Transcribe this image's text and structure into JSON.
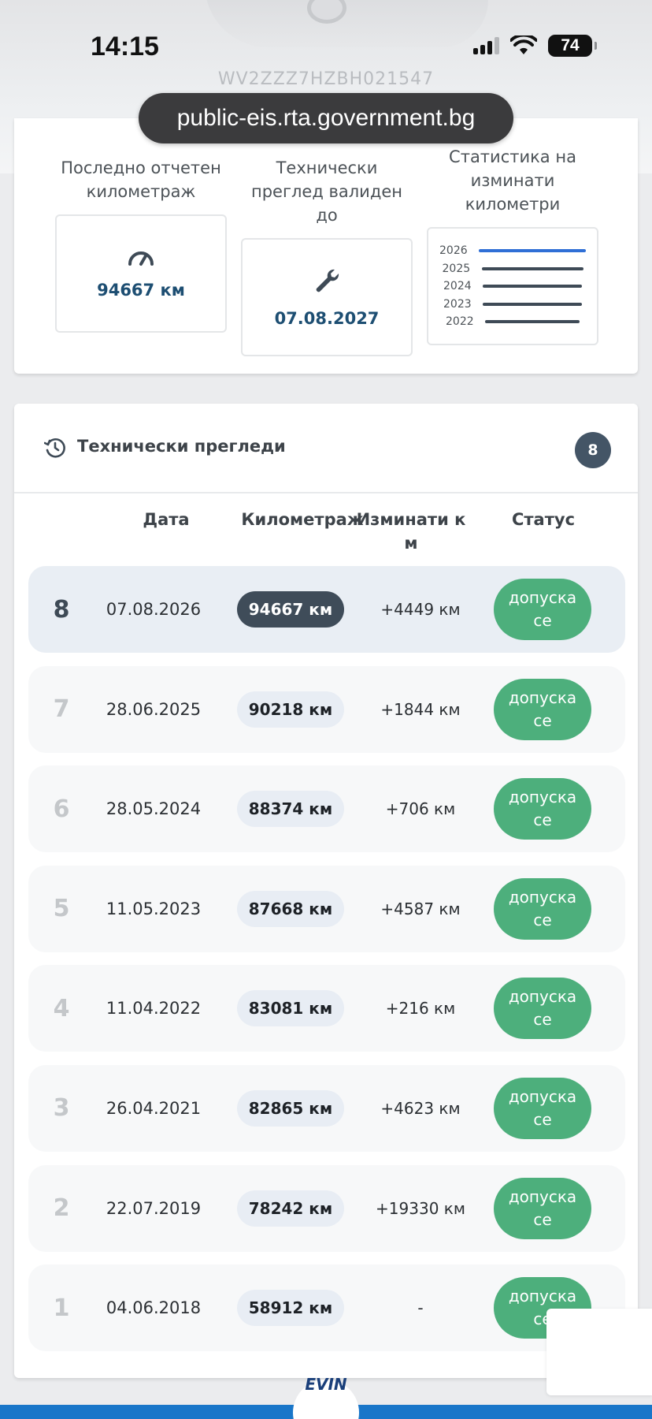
{
  "status_bar": {
    "time": "14:15",
    "battery": "74"
  },
  "vehicle": {
    "vin": "WV2ZZZ7HZBH021547"
  },
  "browser": {
    "url": "public-eis.rta.government.bg"
  },
  "summary": {
    "mileage_label": "Последно отчетен километраж",
    "mileage_value": "94667 км",
    "inspection_label": "Технически преглед валиден до",
    "inspection_value": "07.08.2027",
    "stats_label": "Статистика на изминати километри",
    "stats_chart": {
      "years": [
        "2026",
        "2025",
        "2024",
        "2023",
        "2022"
      ],
      "relative_mileage": [
        1.0,
        0.95,
        0.93,
        0.93,
        0.88
      ],
      "colors": {
        "current": "#2f6fd6",
        "other": "#3e4a56"
      }
    }
  },
  "inspections": {
    "title": "Технически прегледи",
    "count": "8",
    "columns": {
      "date": "Дата",
      "mileage": "Километраж",
      "diff": "Изминати к м",
      "status": "Статус"
    },
    "rows": [
      {
        "num": "8",
        "date": "07.08.2026",
        "km": "94667 км",
        "diff": "+4449 км",
        "status": "допуска се"
      },
      {
        "num": "7",
        "date": "28.06.2025",
        "km": "90218 км",
        "diff": "+1844 км",
        "status": "допуска се"
      },
      {
        "num": "6",
        "date": "28.05.2024",
        "km": "88374 км",
        "diff": "+706 км",
        "status": "допуска се"
      },
      {
        "num": "5",
        "date": "11.05.2023",
        "km": "87668 км",
        "diff": "+4587 км",
        "status": "допуска се"
      },
      {
        "num": "4",
        "date": "11.04.2022",
        "km": "83081 км",
        "diff": "+216 км",
        "status": "допуска се"
      },
      {
        "num": "3",
        "date": "26.04.2021",
        "km": "82865 км",
        "diff": "+4623 км",
        "status": "допуска се"
      },
      {
        "num": "2",
        "date": "22.07.2019",
        "km": "78242 км",
        "diff": "+19330 км",
        "status": "допуска се"
      },
      {
        "num": "1",
        "date": "04.06.2018",
        "km": "58912 км",
        "diff": "-",
        "status": "допуска се"
      }
    ]
  },
  "footer": {
    "logo": "EVIN"
  },
  "colors": {
    "accent": "#1d4e72",
    "status_ok": "#4daf7c",
    "bottom_bar": "#1976c9"
  }
}
